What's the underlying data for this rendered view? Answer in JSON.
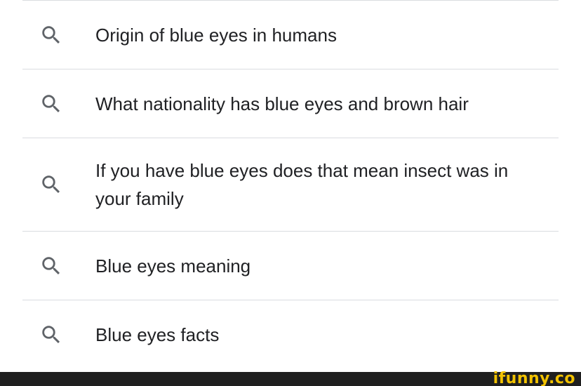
{
  "suggestions": [
    {
      "text": "Origin of blue eyes in humans",
      "icon": "search-icon"
    },
    {
      "text": "What nationality has blue eyes and brown hair",
      "icon": "search-icon"
    },
    {
      "text": "If you have blue eyes does that mean insect was in your family",
      "icon": "search-icon"
    },
    {
      "text": "Blue eyes meaning",
      "icon": "search-icon"
    },
    {
      "text": "Blue eyes facts",
      "icon": "search-icon"
    }
  ],
  "footer": {
    "brand": "ifunny.co"
  },
  "colors": {
    "text": "#202124",
    "icon": "#5f6368",
    "divider": "#dadce0",
    "footer_bg": "#1f1f1f",
    "brand": "#f2c200"
  }
}
